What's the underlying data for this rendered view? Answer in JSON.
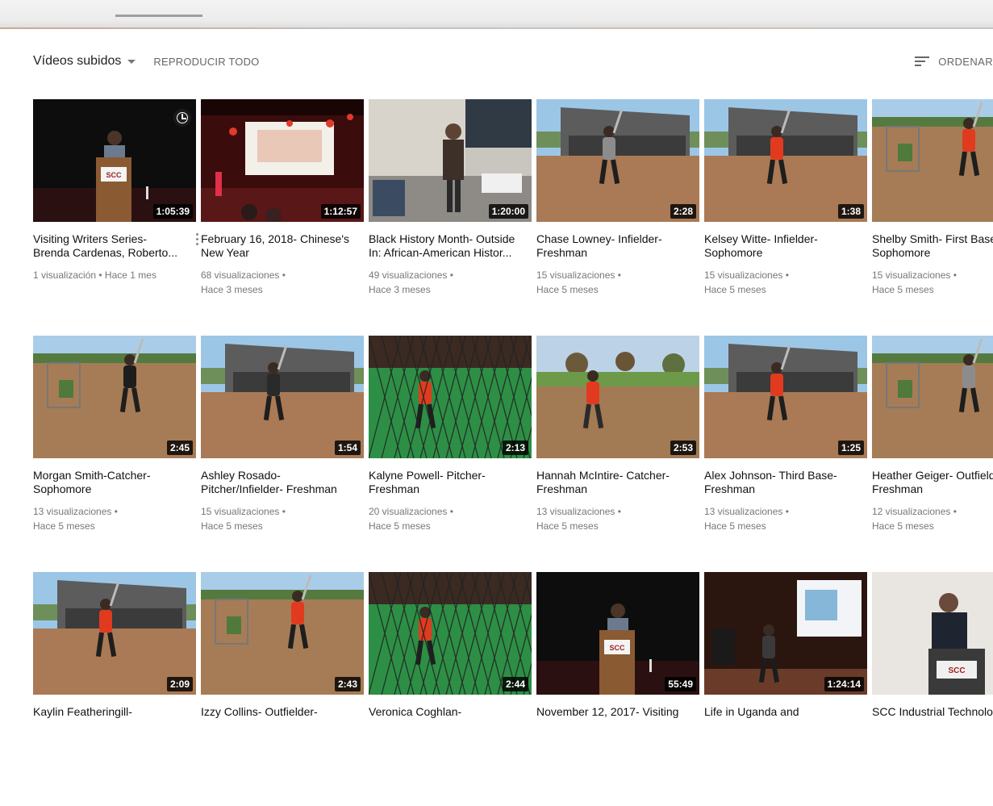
{
  "shelf": {
    "title": "Vídeos subidos",
    "play_all": "REPRODUCIR TODO",
    "sort_label": "ORDENAR"
  },
  "videos": [
    {
      "title": "Visiting Writers Series- Brenda Cardenas, Roberto...",
      "views": "1 visualización",
      "age": "Hace 1 mes",
      "duration": "1:05:39",
      "thumb": "podium-dark"
    },
    {
      "title": "February 16, 2018- Chinese's New Year",
      "views": "68 visualizaciones",
      "age": "Hace 3 meses",
      "duration": "1:12:57",
      "thumb": "stage-red"
    },
    {
      "title": "Black History Month- Outside In: African-American Histor...",
      "views": "49 visualizaciones",
      "age": "Hace 3 meses",
      "duration": "1:20:00",
      "thumb": "classroom"
    },
    {
      "title": "Chase Lowney- Infielder- Freshman",
      "views": "15 visualizaciones",
      "age": "Hace 5 meses",
      "duration": "2:28",
      "thumb": "field-dugout-gray"
    },
    {
      "title": "Kelsey Witte- Infielder- Sophomore",
      "views": "15 visualizaciones",
      "age": "Hace 5 meses",
      "duration": "1:38",
      "thumb": "field-dugout-red"
    },
    {
      "title": "Shelby Smith- First Base- Sophomore",
      "views": "15 visualizaciones",
      "age": "Hace 5 meses",
      "duration": "",
      "thumb": "field-cage-red"
    },
    {
      "title": "Morgan Smith-Catcher- Sophomore",
      "views": "13 visualizaciones",
      "age": "Hace 5 meses",
      "duration": "2:45",
      "thumb": "field-cage-dark"
    },
    {
      "title": "Ashley Rosado- Pitcher/Infielder- Freshman",
      "views": "15 visualizaciones",
      "age": "Hace 5 meses",
      "duration": "1:54",
      "thumb": "field-dugout-dark"
    },
    {
      "title": "Kalyne Powell- Pitcher- Freshman",
      "views": "20 visualizaciones",
      "age": "Hace 5 meses",
      "duration": "2:13",
      "thumb": "net-green"
    },
    {
      "title": "Hannah McIntire- Catcher- Freshman",
      "views": "13 visualizaciones",
      "age": "Hace 5 meses",
      "duration": "2:53",
      "thumb": "field-trees-red"
    },
    {
      "title": "Alex Johnson- Third Base- Freshman",
      "views": "13 visualizaciones",
      "age": "Hace 5 meses",
      "duration": "1:25",
      "thumb": "field-dugout-red"
    },
    {
      "title": "Heather Geiger- Outfielder- Freshman",
      "views": "12 visualizaciones",
      "age": "Hace 5 meses",
      "duration": "",
      "thumb": "field-cage-gray"
    },
    {
      "title": "Kaylin Featheringill-",
      "views": "",
      "age": "",
      "duration": "2:09",
      "thumb": "field-dugout-red"
    },
    {
      "title": "Izzy Collins- Outfielder-",
      "views": "",
      "age": "",
      "duration": "2:43",
      "thumb": "field-cage-red"
    },
    {
      "title": "Veronica Coghlan-",
      "views": "",
      "age": "",
      "duration": "2:44",
      "thumb": "net-green"
    },
    {
      "title": "November 12, 2017- Visiting",
      "views": "",
      "age": "",
      "duration": "55:49",
      "thumb": "podium-dark"
    },
    {
      "title": "Life in Uganda and",
      "views": "",
      "age": "",
      "duration": "1:24:14",
      "thumb": "stage-projector"
    },
    {
      "title": "SCC Industrial Technology",
      "views": "",
      "age": "",
      "duration": "",
      "thumb": "speaker-flag"
    }
  ],
  "meta_separator": " • ",
  "colors": {
    "duration_bg": "#000000",
    "meta_text": "#777777",
    "title_text": "#111111"
  },
  "icons": {
    "sort": "sort-icon",
    "watch_later": "clock-icon",
    "menu": "kebab-menu-icon",
    "dropdown": "caret-down-icon"
  }
}
